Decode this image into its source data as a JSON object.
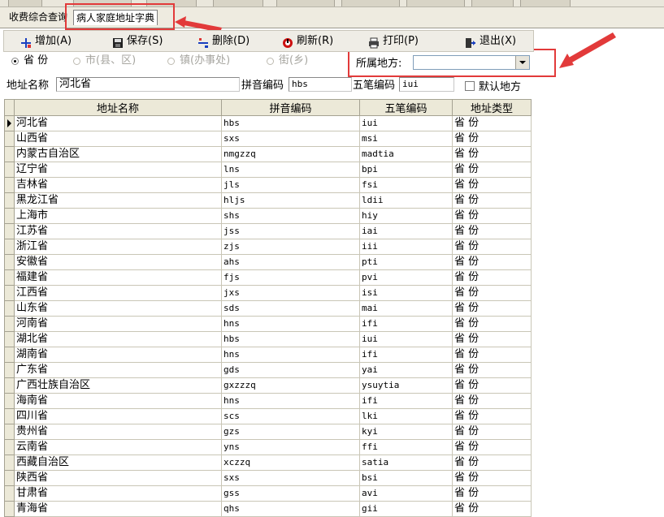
{
  "tabs": [
    {
      "label": "收费综合查询"
    },
    {
      "label": "病人家庭地址字典"
    }
  ],
  "toolbar": {
    "add": "增加(A)",
    "save": "保存(S)",
    "delete": "删除(D)",
    "refresh": "刷新(R)",
    "print": "打印(P)",
    "exit": "退出(X)"
  },
  "radios": {
    "province": "省 份",
    "city": "市(县、区)",
    "town": "镇(办事处)",
    "street": "街(乡)"
  },
  "region": {
    "label": "所属地方:",
    "value": ""
  },
  "form": {
    "name_label": "地址名称",
    "name_value": "河北省",
    "pinyin_label": "拼音编码",
    "pinyin_value": "hbs",
    "wubi_label": "五笔编码",
    "wubi_value": "iui",
    "default_label": "默认地方"
  },
  "grid": {
    "columns": [
      "地址名称",
      "拼音编码",
      "五笔编码",
      "地址类型"
    ],
    "rows": [
      [
        "河北省",
        "hbs",
        "iui",
        "省 份"
      ],
      [
        "山西省",
        "sxs",
        "msi",
        "省 份"
      ],
      [
        "内蒙古自治区",
        "nmgzzq",
        "madtia",
        "省 份"
      ],
      [
        "辽宁省",
        "lns",
        "bpi",
        "省 份"
      ],
      [
        "吉林省",
        "jls",
        "fsi",
        "省 份"
      ],
      [
        "黑龙江省",
        "hljs",
        "ldii",
        "省 份"
      ],
      [
        "上海市",
        "shs",
        "hiy",
        "省 份"
      ],
      [
        "江苏省",
        "jss",
        "iai",
        "省 份"
      ],
      [
        "浙江省",
        "zjs",
        "iii",
        "省 份"
      ],
      [
        "安徽省",
        "ahs",
        "pti",
        "省 份"
      ],
      [
        "福建省",
        "fjs",
        "pvi",
        "省 份"
      ],
      [
        "江西省",
        "jxs",
        "isi",
        "省 份"
      ],
      [
        "山东省",
        "sds",
        "mai",
        "省 份"
      ],
      [
        "河南省",
        "hns",
        "ifi",
        "省 份"
      ],
      [
        "湖北省",
        "hbs",
        "iui",
        "省 份"
      ],
      [
        "湖南省",
        "hns",
        "ifi",
        "省 份"
      ],
      [
        "广东省",
        "gds",
        "yai",
        "省 份"
      ],
      [
        "广西壮族自治区",
        "gxzzzq",
        "ysuytia",
        "省 份"
      ],
      [
        "海南省",
        "hns",
        "ifi",
        "省 份"
      ],
      [
        "四川省",
        "scs",
        "lki",
        "省 份"
      ],
      [
        "贵州省",
        "gzs",
        "kyi",
        "省 份"
      ],
      [
        "云南省",
        "yns",
        "ffi",
        "省 份"
      ],
      [
        "西藏自治区",
        "xczzq",
        "satia",
        "省 份"
      ],
      [
        "陕西省",
        "sxs",
        "bsi",
        "省 份"
      ],
      [
        "甘肃省",
        "gss",
        "avi",
        "省 份"
      ],
      [
        "青海省",
        "qhs",
        "gii",
        "省 份"
      ]
    ]
  }
}
